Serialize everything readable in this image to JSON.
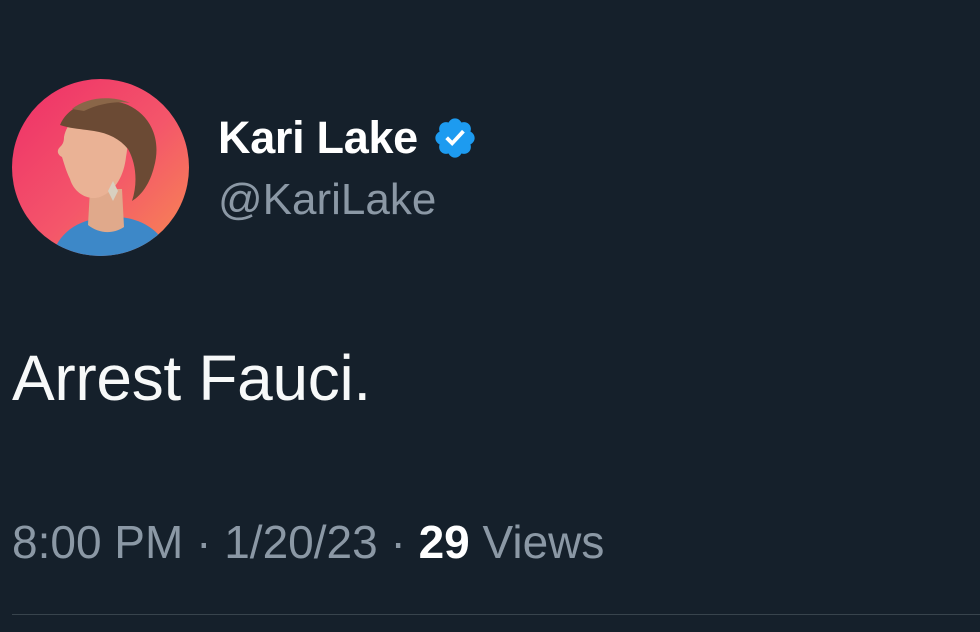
{
  "author": {
    "display_name": "Kari Lake",
    "handle": "@KariLake",
    "verified_icon": "verified-badge-icon"
  },
  "tweet": {
    "text": "Arrest Fauci."
  },
  "meta": {
    "time": "8:00 PM",
    "separator": "·",
    "date": "1/20/23",
    "views_count": "29",
    "views_label": "Views"
  },
  "colors": {
    "background": "#15202b",
    "primary_text": "#ffffff",
    "secondary_text": "#8b98a5",
    "verified_blue": "#1d9bf0",
    "divider": "#38444d"
  }
}
